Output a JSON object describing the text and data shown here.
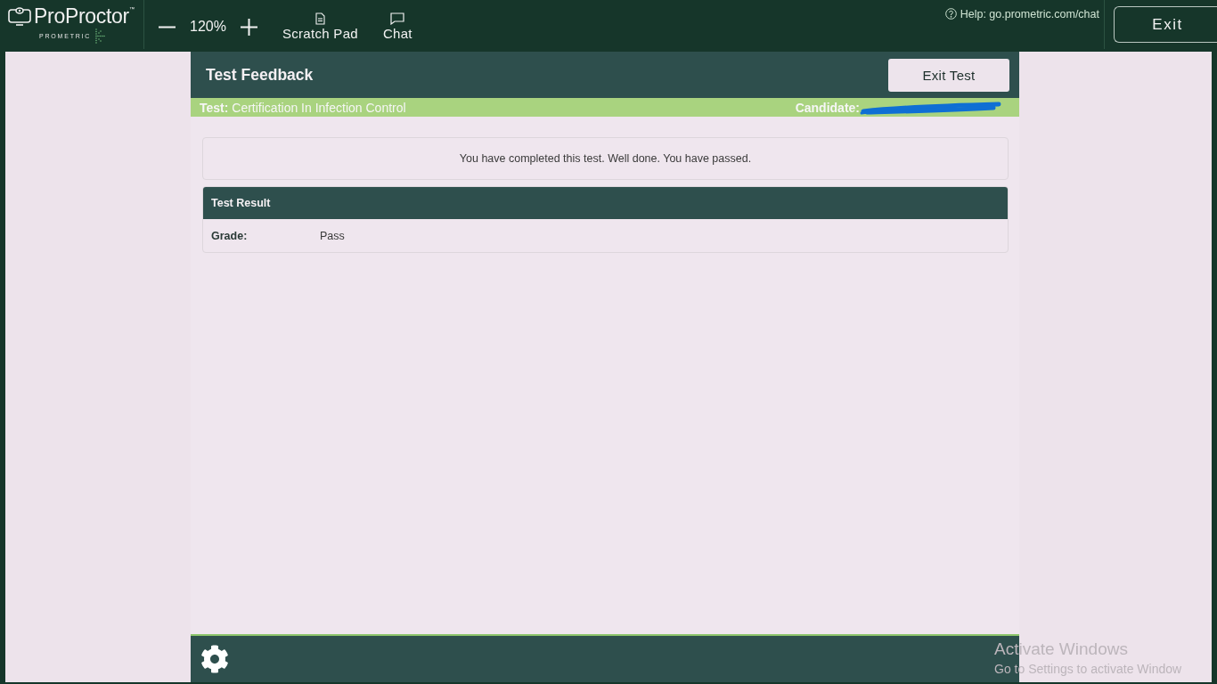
{
  "top_bar": {
    "logo": {
      "name": "ProProctor$^{™}$",
      "brand": "PROMETRIC"
    },
    "zoom": {
      "value": "120%"
    },
    "tools": [
      {
        "kind": "scratch_pad",
        "label": "Scratch Pad"
      },
      {
        "kind": "chat",
        "label": "Chat"
      }
    ],
    "help": "Help: go.prometric.com/chat",
    "exit_button": "Exit"
  },
  "header": {
    "title": "Test Feedback",
    "exit_button": "Exit Test"
  },
  "info_bar": {
    "test": "**Test:** Certification In Infection Control",
    "candidate": {
      "label": "Candidate:",
      "redacted": true
    }
  },
  "message": "You have completed this test. Well done. You have passed.",
  "result_panel": {
    "title": "Test Result",
    "rows": [
      {
        "label": "Grade:",
        "value": "Pass"
      }
    ]
  },
  "os_notice": {
    "title": "Activate Windows",
    "text": "Go to Settings to activate Window"
  }
}
